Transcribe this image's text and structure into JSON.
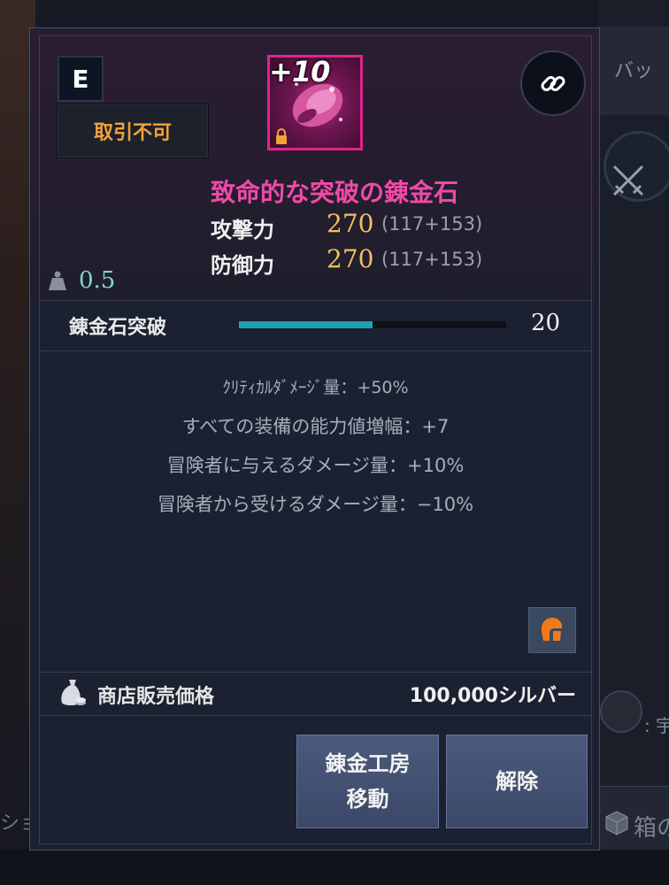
{
  "background": {
    "tab_label": "バッ",
    "hint_text": ": 宇",
    "box_label": "箱の",
    "left_text": "ション"
  },
  "item": {
    "grade": "E",
    "trade_status": "取引不可",
    "enhance_level": "+10",
    "name": "致命的な突破の錬金石",
    "stats": [
      {
        "label": "攻撃力",
        "value": "270",
        "detail": "(117+153)"
      },
      {
        "label": "防御力",
        "value": "270",
        "detail": "(117+153)"
      }
    ],
    "weight": "0.5"
  },
  "breakthrough": {
    "label": "錬金石突破",
    "value": "20",
    "progress_fraction": 0.5
  },
  "effects": [
    "ｸﾘﾃｨｶﾙﾀﾞﾒｰｼﾞ量：+50%",
    "すべての装備の能力値増幅：+7",
    "冒険者に与えるダメージ量：+10%",
    "冒険者から受けるダメージ量：−10%"
  ],
  "price": {
    "label": "商店販売価格",
    "value": "100,000シルバー"
  },
  "buttons": {
    "workshop": "錬金工房\n移動",
    "release": "解除"
  },
  "colors": {
    "item_name": "#f04aa8",
    "trade_status": "#f2a13a",
    "stat_value": "#f2c063",
    "weight": "#7fd6c8",
    "progress": "#1f9fb4",
    "button": "#4b5a7c"
  },
  "icons": [
    "link-icon",
    "weight-icon",
    "lock-icon",
    "class-helmet-icon",
    "money-bag-icon",
    "crossed-swords-icon"
  ]
}
